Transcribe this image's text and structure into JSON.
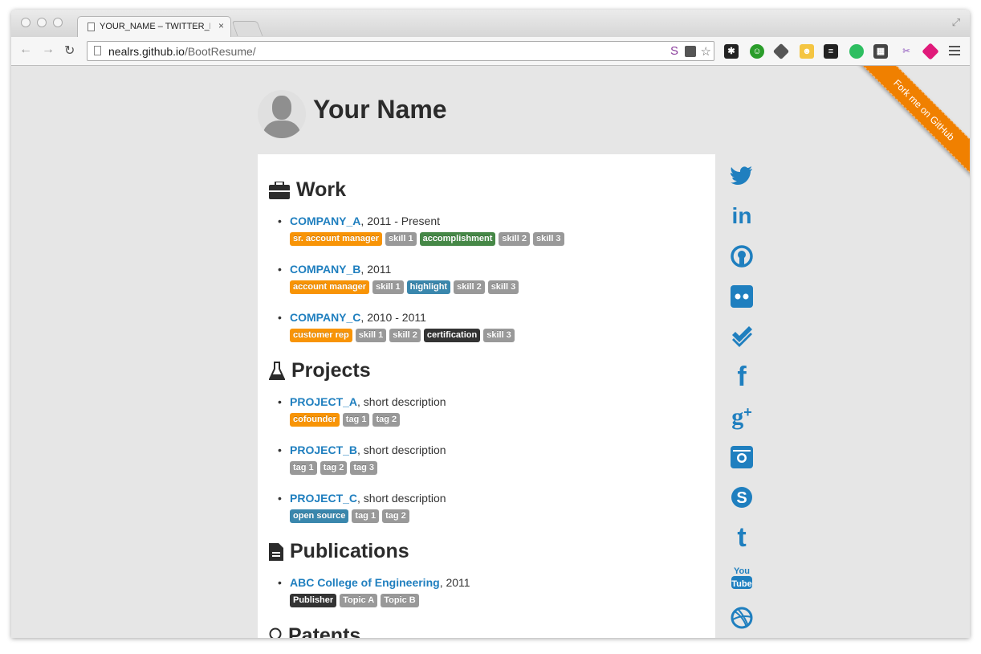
{
  "browser": {
    "tab_title": "YOUR_NAME – TWITTER_HA",
    "tab_close": "×",
    "url_host": "nealrs.github.io",
    "url_path": "/BootResume/",
    "back": "←",
    "forward": "→",
    "reload": "↻",
    "omnibox_s": "S",
    "star": "☆",
    "resize": "⤢"
  },
  "header": {
    "name": "Your Name"
  },
  "ribbon": {
    "text": "Fork me on GitHub"
  },
  "sections": {
    "work": "Work",
    "projects": "Projects",
    "publications": "Publications",
    "patents": "Patents"
  },
  "work": [
    {
      "company": "COMPANY_A",
      "dates": ", 2011 - Present",
      "tags": [
        [
          "sr. account manager",
          "warning"
        ],
        [
          "skill 1",
          "default"
        ],
        [
          "accomplishment",
          "success"
        ],
        [
          "skill 2",
          "default"
        ],
        [
          "skill 3",
          "default"
        ]
      ]
    },
    {
      "company": "COMPANY_B",
      "dates": ", 2011",
      "tags": [
        [
          "account manager",
          "warning"
        ],
        [
          "skill 1",
          "default"
        ],
        [
          "highlight",
          "info"
        ],
        [
          "skill 2",
          "default"
        ],
        [
          "skill 3",
          "default"
        ]
      ]
    },
    {
      "company": "COMPANY_C",
      "dates": ", 2010 - 2011",
      "tags": [
        [
          "customer rep",
          "warning"
        ],
        [
          "skill 1",
          "default"
        ],
        [
          "skill 2",
          "default"
        ],
        [
          "certification",
          "inverse"
        ],
        [
          "skill 3",
          "default"
        ]
      ]
    }
  ],
  "projects": [
    {
      "name": "PROJECT_A",
      "desc": ", short description",
      "tags": [
        [
          "cofounder",
          "warning"
        ],
        [
          "tag 1",
          "default"
        ],
        [
          "tag 2",
          "default"
        ]
      ]
    },
    {
      "name": "PROJECT_B",
      "desc": ", short description",
      "tags": [
        [
          "tag 1",
          "default"
        ],
        [
          "tag 2",
          "default"
        ],
        [
          "tag 3",
          "default"
        ]
      ]
    },
    {
      "name": "PROJECT_C",
      "desc": ", short description",
      "tags": [
        [
          "open source",
          "info"
        ],
        [
          "tag 1",
          "default"
        ],
        [
          "tag 2",
          "default"
        ]
      ]
    }
  ],
  "publications": [
    {
      "name": "ABC College of Engineering",
      "year": ", 2011",
      "tags": [
        [
          "Publisher",
          "inverse"
        ],
        [
          "Topic A",
          "default"
        ],
        [
          "Topic B",
          "default"
        ]
      ]
    }
  ],
  "social_icons": [
    "twitter-icon",
    "linkedin-icon",
    "github-icon",
    "flickr-icon",
    "foursquare-icon",
    "facebook-icon",
    "google-plus-icon",
    "instagram-icon",
    "skype-icon",
    "tumblr-icon",
    "youtube-icon",
    "dribbble-icon"
  ],
  "colors": {
    "link": "#1f7fbf",
    "warning": "#f89406",
    "default": "#999999",
    "success": "#468847",
    "info": "#3a87ad",
    "inverse": "#333333",
    "ribbon": "#f08000"
  }
}
